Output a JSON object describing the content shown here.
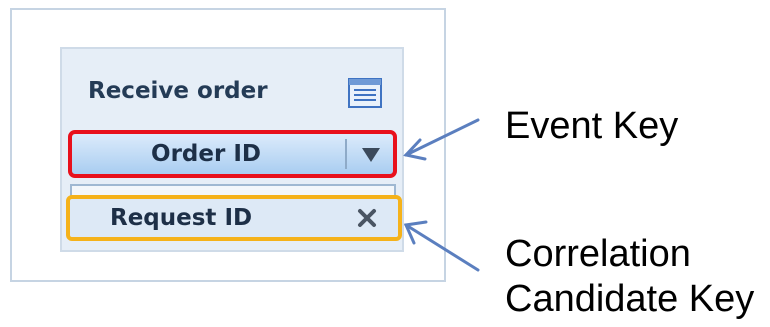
{
  "card": {
    "title": "Receive order",
    "icon": "table-icon"
  },
  "event_key": {
    "label": "Order ID",
    "dropdown_icon": "triangle-down-icon",
    "highlight_color": "#e8101c"
  },
  "candidate_key": {
    "label": "Request ID",
    "remove_icon": "close-icon",
    "highlight_color": "#f5b21a"
  },
  "callouts": {
    "event_key_label": "Event Key",
    "candidate_key_line1": "Correlation",
    "candidate_key_line2": "Candidate Key",
    "arrow_color": "#5b7fbf"
  }
}
